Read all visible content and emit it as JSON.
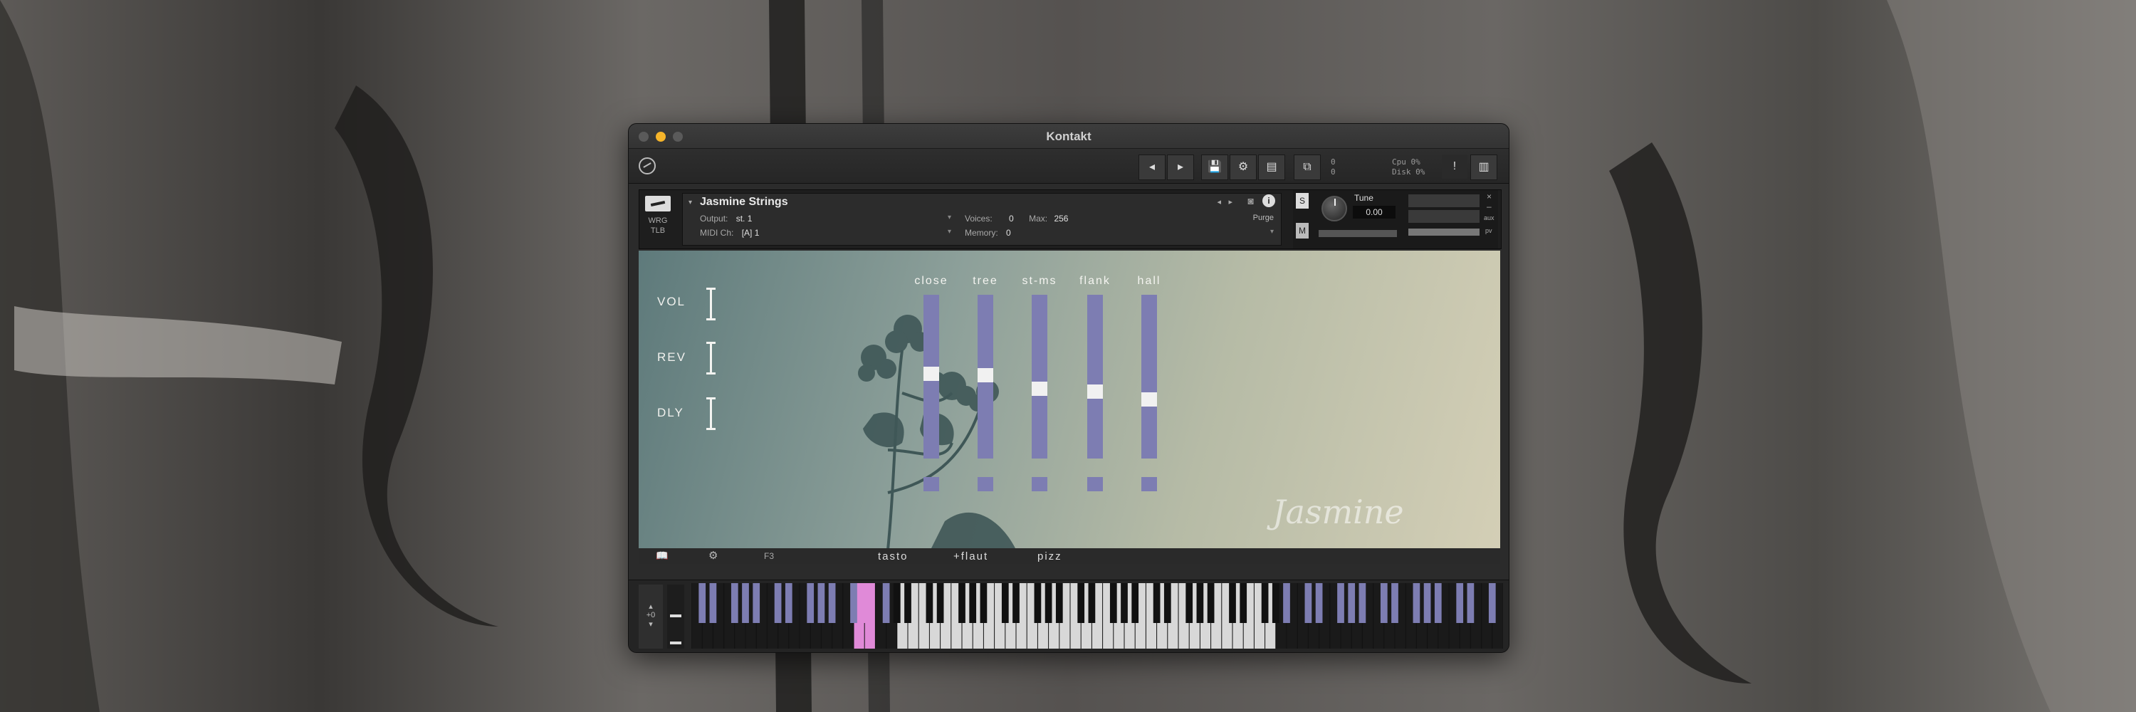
{
  "window": {
    "title": "Kontakt"
  },
  "toolbar": {
    "prev_icon": "chevron-left-icon",
    "next_icon": "chevron-right-icon",
    "cpu_label": "Cpu",
    "cpu_value": "0%",
    "disk_label": "Disk",
    "disk_value": "0%",
    "voices_count": "0",
    "voices_count2": "0"
  },
  "instrument": {
    "badge": "WRG TLB",
    "name": "Jasmine Strings",
    "output_label": "Output:",
    "output_value": "st. 1",
    "midi_label": "MIDI Ch:",
    "midi_value": "[A] 1",
    "voices_label": "Voices:",
    "voices_value": "0",
    "max_label": "Max:",
    "max_value": "256",
    "memory_label": "Memory:",
    "memory_value": "0",
    "purge_label": "Purge",
    "tune_label": "Tune",
    "tune_value": "0.00",
    "s_label": "S",
    "m_label": "M",
    "aux_label": "aux",
    "pv_label": "pv"
  },
  "fx": [
    {
      "label": "VOL"
    },
    {
      "label": "REV"
    },
    {
      "label": "DLY"
    }
  ],
  "mics": [
    {
      "label": "close",
      "level": 0.52
    },
    {
      "label": "tree",
      "level": 0.51
    },
    {
      "label": "st-ms",
      "level": 0.42
    },
    {
      "label": "flank",
      "level": 0.4
    },
    {
      "label": "hall",
      "level": 0.35
    }
  ],
  "bottom": {
    "key_label": "F3",
    "articulations": [
      "tasto",
      "+flaut",
      "pizz"
    ]
  },
  "signature_text": "Jasmine",
  "keyboard": {
    "octave_value": "+0"
  },
  "colors": {
    "accent": "#7d7db2",
    "pressed_key": "#e08ad8",
    "traffic_yellow": "#f5b42a"
  }
}
